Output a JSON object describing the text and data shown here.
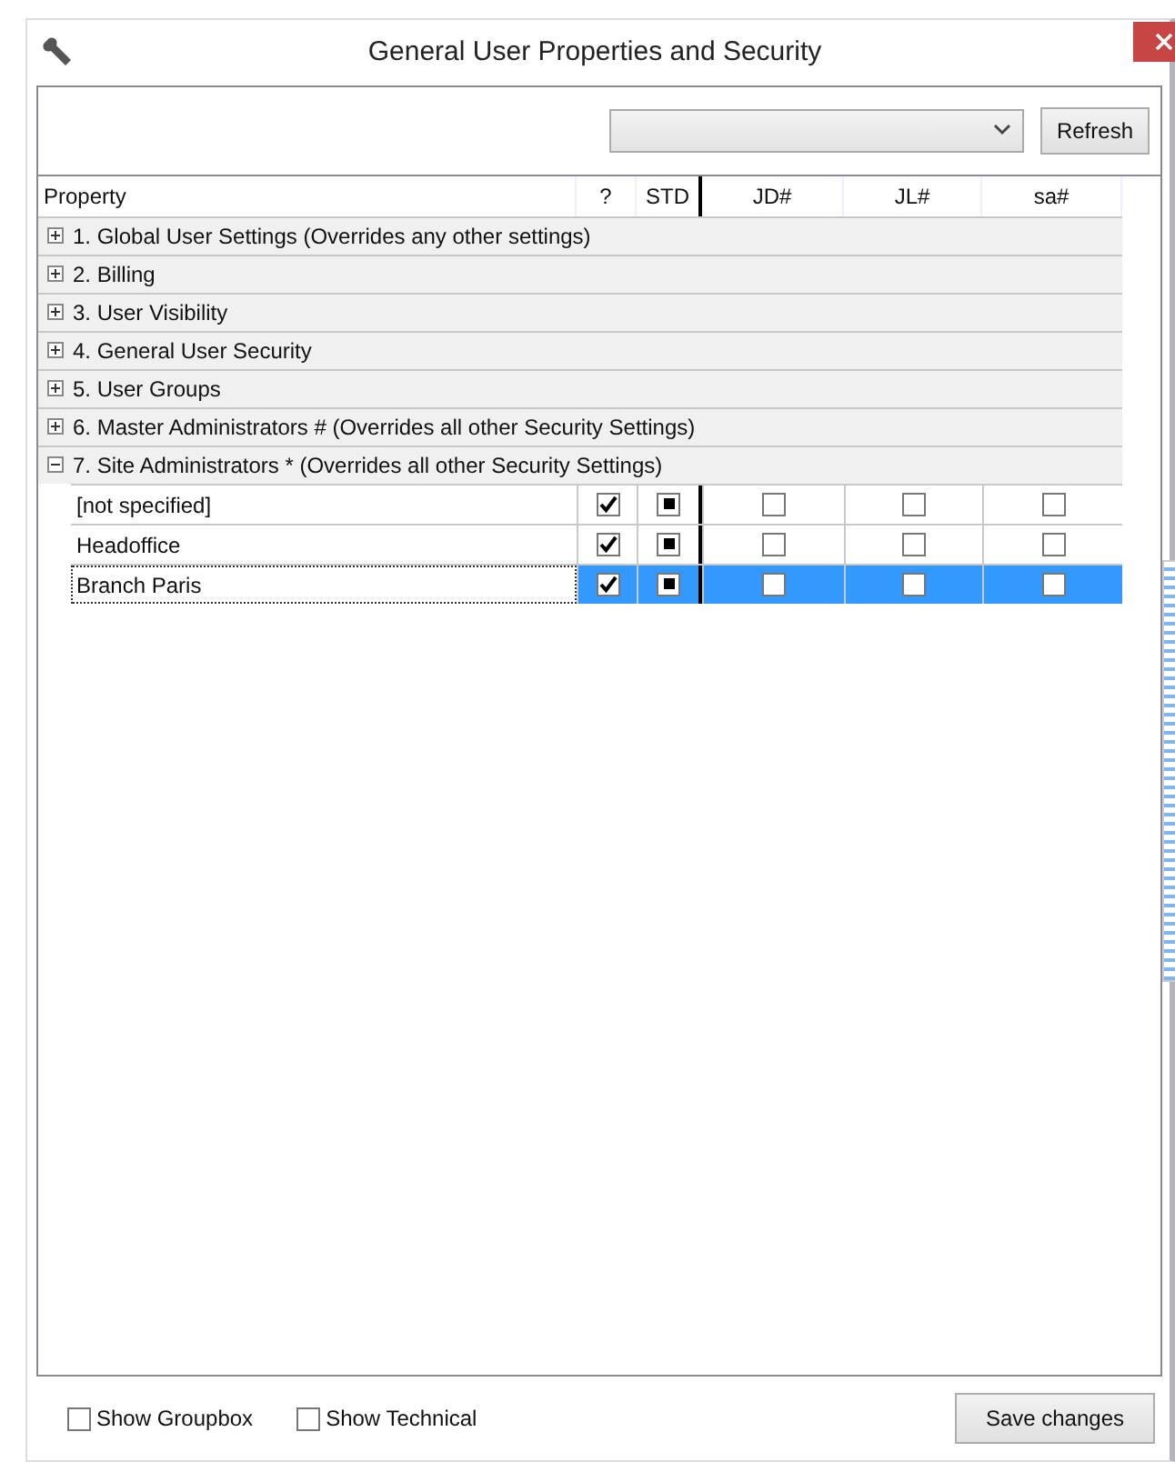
{
  "window": {
    "title": "General User Properties and Security"
  },
  "toolbar": {
    "refresh_button": "Refresh"
  },
  "grid": {
    "columns": [
      "Property",
      "?",
      "STD",
      "JD#",
      "JL#",
      "sa#"
    ],
    "groups": [
      {
        "label": "1. Global User Settings (Overrides any other settings)",
        "expanded": false
      },
      {
        "label": "2. Billing",
        "expanded": false
      },
      {
        "label": "3. User Visibility",
        "expanded": false
      },
      {
        "label": "4. General User Security",
        "expanded": false
      },
      {
        "label": "5. User Groups",
        "expanded": false
      },
      {
        "label": "6. Master Administrators # (Overrides all other Security Settings)",
        "expanded": false
      },
      {
        "label": "7. Site Administrators * (Overrides all other Security Settings)",
        "expanded": true,
        "rows": [
          {
            "name": "[not specified]",
            "selected": false,
            "cells": [
              {
                "kind": "tick",
                "checked": true
              },
              {
                "kind": "square",
                "checked": true
              },
              {
                "checked": false
              },
              {
                "checked": false
              },
              {
                "checked": false
              }
            ]
          },
          {
            "name": "Headoffice",
            "selected": false,
            "cells": [
              {
                "kind": "tick",
                "checked": true
              },
              {
                "kind": "square",
                "checked": true
              },
              {
                "checked": false
              },
              {
                "checked": false
              },
              {
                "checked": false
              }
            ]
          },
          {
            "name": "Branch Paris",
            "selected": true,
            "cells": [
              {
                "kind": "tick",
                "checked": true
              },
              {
                "kind": "square",
                "checked": true
              },
              {
                "checked": false
              },
              {
                "checked": false
              },
              {
                "checked": false
              }
            ]
          }
        ]
      }
    ]
  },
  "footer": {
    "options": [
      {
        "label": "Show Groupbox",
        "checked": false
      },
      {
        "label": "Show Technical",
        "checked": false
      }
    ],
    "save_button": "Save changes"
  }
}
